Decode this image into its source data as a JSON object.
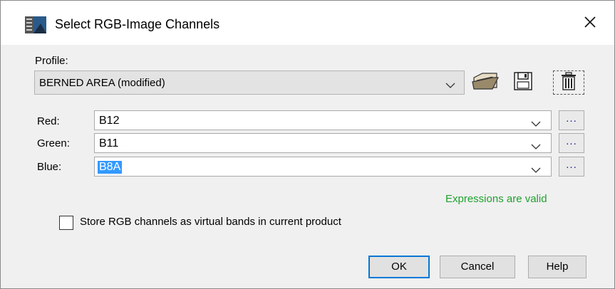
{
  "window": {
    "title": "Select RGB-Image Channels"
  },
  "icons": {
    "app": "image-channels-icon",
    "close": "close-icon",
    "open": "open-folder-icon",
    "save": "save-disk-icon",
    "delete": "trash-icon",
    "dropdown": "chevron-down-icon"
  },
  "profile": {
    "label": "Profile:",
    "value": "BERNED AREA (modified)"
  },
  "channels": [
    {
      "label": "Red:",
      "value": "B12",
      "more": "..."
    },
    {
      "label": "Green:",
      "value": "B11",
      "more": "..."
    },
    {
      "label": "Blue:",
      "value": "B8A",
      "more": "..."
    }
  ],
  "status": {
    "text": "Expressions are valid",
    "color": "#1fa12e"
  },
  "virtual_bands": {
    "label": "Store RGB channels as virtual bands in current product",
    "checked": false
  },
  "buttons": {
    "ok": "OK",
    "cancel": "Cancel",
    "help": "Help"
  },
  "colors": {
    "accent": "#0078d7",
    "selection": "#3399ff"
  }
}
